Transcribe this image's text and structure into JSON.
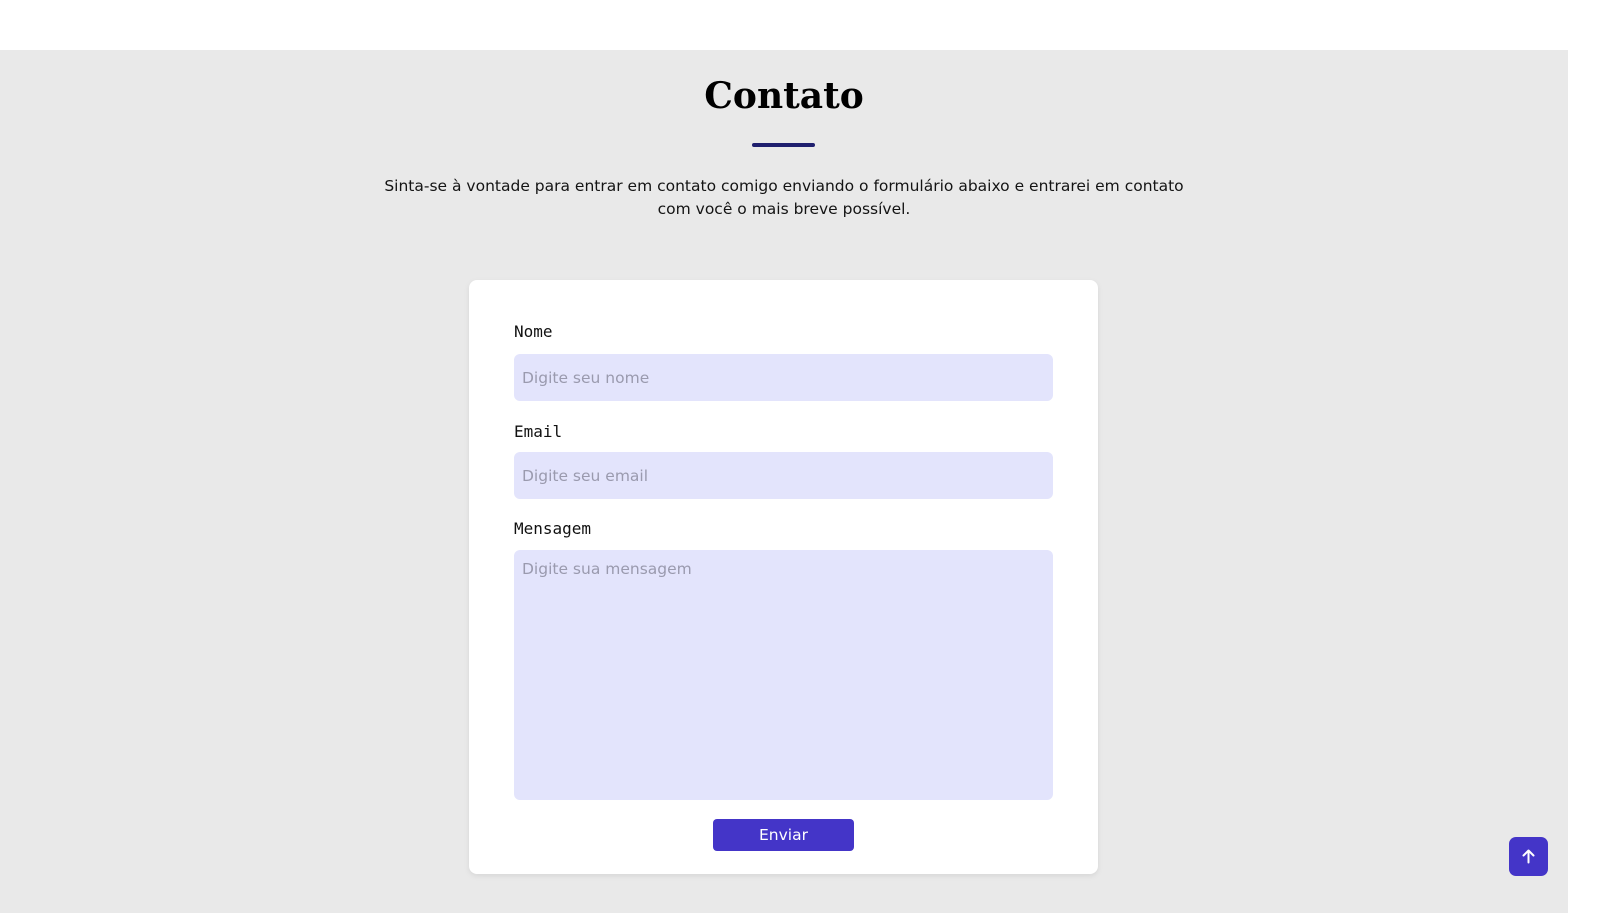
{
  "section": {
    "title": "Contato",
    "description": "Sinta-se à vontade para entrar em contato comigo enviando o formulário abaixo e entrarei em contato com você o mais breve possível."
  },
  "form": {
    "name_label": "Nome",
    "name_placeholder": "Digite seu nome",
    "email_label": "Email",
    "email_placeholder": "Digite seu email",
    "message_label": "Mensagem",
    "message_placeholder": "Digite sua mensagem",
    "submit_label": "Enviar"
  },
  "back_to_top": {
    "icon": "arrow-up-icon"
  },
  "colors": {
    "accent": "#4435c8",
    "input_background": "#e3e4fc",
    "page_background": "#e9e9e9",
    "title_underline": "#1f1f6e"
  }
}
